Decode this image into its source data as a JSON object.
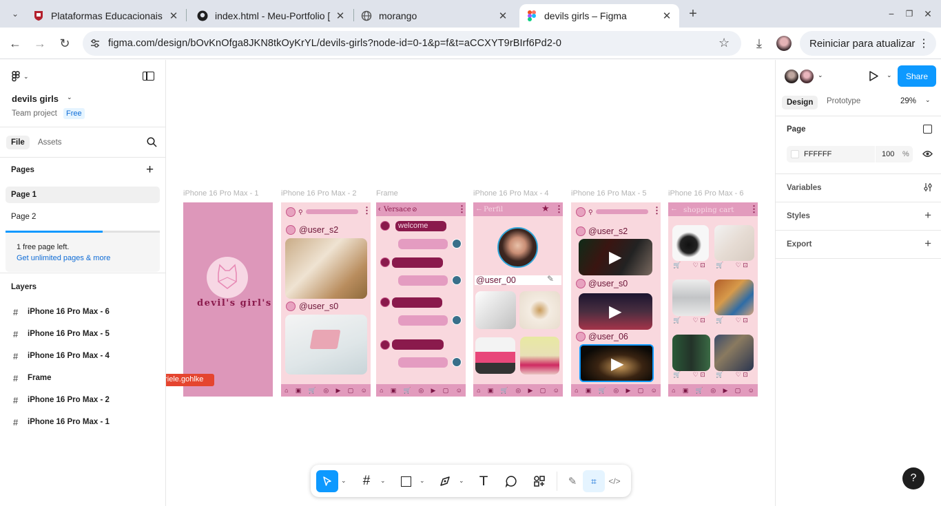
{
  "browser": {
    "tabs": [
      {
        "title": "Plataformas Educacionais",
        "icon": "university-crest-icon"
      },
      {
        "title": "index.html - Meu-Portfolio [",
        "icon": "github-icon"
      },
      {
        "title": "morango",
        "icon": "globe-icon"
      },
      {
        "title": "devils girls – Figma",
        "icon": "figma-icon"
      }
    ],
    "url": "figma.com/design/bOvKnOfga8JKN8tkOyKrYL/devils-girls?node-id=0-1&p=f&t=aCCXYT9rBIrf6Pd2-0",
    "update_label": "Reiniciar para atualizar"
  },
  "left_panel": {
    "project_name": "devils girls",
    "team": "Team project",
    "plan_badge": "Free",
    "tab_file": "File",
    "tab_assets": "Assets",
    "pages_heading": "Pages",
    "pages": [
      "Page 1",
      "Page 2"
    ],
    "free_pages_note": "1 free page left.",
    "upgrade_link": "Get unlimited pages & more",
    "free_pages_used_fraction": 0.63,
    "layers_heading": "Layers",
    "layers": [
      "iPhone 16 Pro Max - 6",
      "iPhone 16 Pro Max - 5",
      "iPhone 16 Pro Max - 4",
      "Frame",
      "iPhone 16 Pro Max - 2",
      "iPhone 16 Pro Max - 1"
    ]
  },
  "canvas": {
    "frame_labels": [
      "iPhone 16 Pro Max - 1",
      "iPhone 16 Pro Max - 2",
      "Frame",
      "iPhone 16 Pro Max - 4",
      "iPhone 16 Pro Max - 5",
      "iPhone 16 Pro Max - 6"
    ],
    "cursor_user": "briele.gohlke",
    "frame1": {
      "logo_text": "devil's girl's"
    },
    "frame2": {
      "usernames": [
        "@user_s2",
        "@user_s0"
      ]
    },
    "frame3": {
      "header": "Versace",
      "welcome": "welcome"
    },
    "frame4": {
      "header": "Perfil",
      "username": "@user_00"
    },
    "frame5": {
      "usernames": [
        "@user_s2",
        "@user_s0",
        "@user_06"
      ]
    },
    "frame6": {
      "header": "shopping cart"
    }
  },
  "right_panel": {
    "share_label": "Share",
    "tab_design": "Design",
    "tab_prototype": "Prototype",
    "zoom": "29%",
    "page_heading": "Page",
    "page_color_hex": "FFFFFF",
    "page_opacity": "100",
    "percent": "%",
    "variables_label": "Variables",
    "styles_label": "Styles",
    "export_label": "Export"
  },
  "help_label": "?",
  "colors": {
    "figma_blue": "#0d99ff",
    "frame_pink": "#f9d8de",
    "accent_magenta": "#e29bbd",
    "cursor_red": "#e5452f"
  }
}
